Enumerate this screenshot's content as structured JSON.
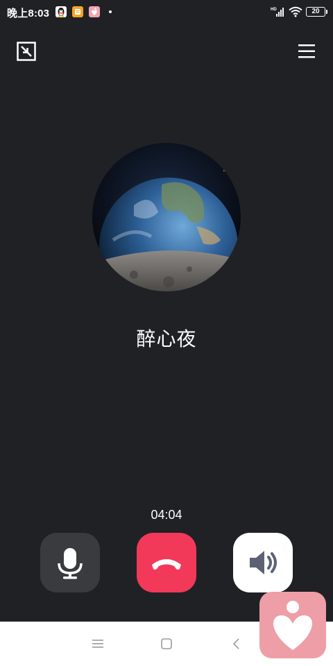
{
  "status_bar": {
    "time": "晚上8:03",
    "network": "HD",
    "battery": "20",
    "icons": [
      "qq-icon",
      "orange-app-icon",
      "pink-app-icon",
      "signal-icon",
      "wifi-icon",
      "battery-icon"
    ]
  },
  "call": {
    "caller_name": "醉心夜",
    "duration": "04:04"
  },
  "controls": {
    "top": [
      "minimize-icon",
      "menu-icon"
    ],
    "bottom": [
      "microphone-icon",
      "hang-up-icon",
      "speaker-icon"
    ]
  },
  "colors": {
    "background": "#202124",
    "hangup": "#f2395a",
    "mic_bg": "#3a3b3f",
    "speaker_bg": "#ffffff",
    "floating_app": "#ee9ea6"
  },
  "nav_bar": {
    "icons": [
      "menu-icon",
      "home-icon",
      "back-icon"
    ]
  }
}
